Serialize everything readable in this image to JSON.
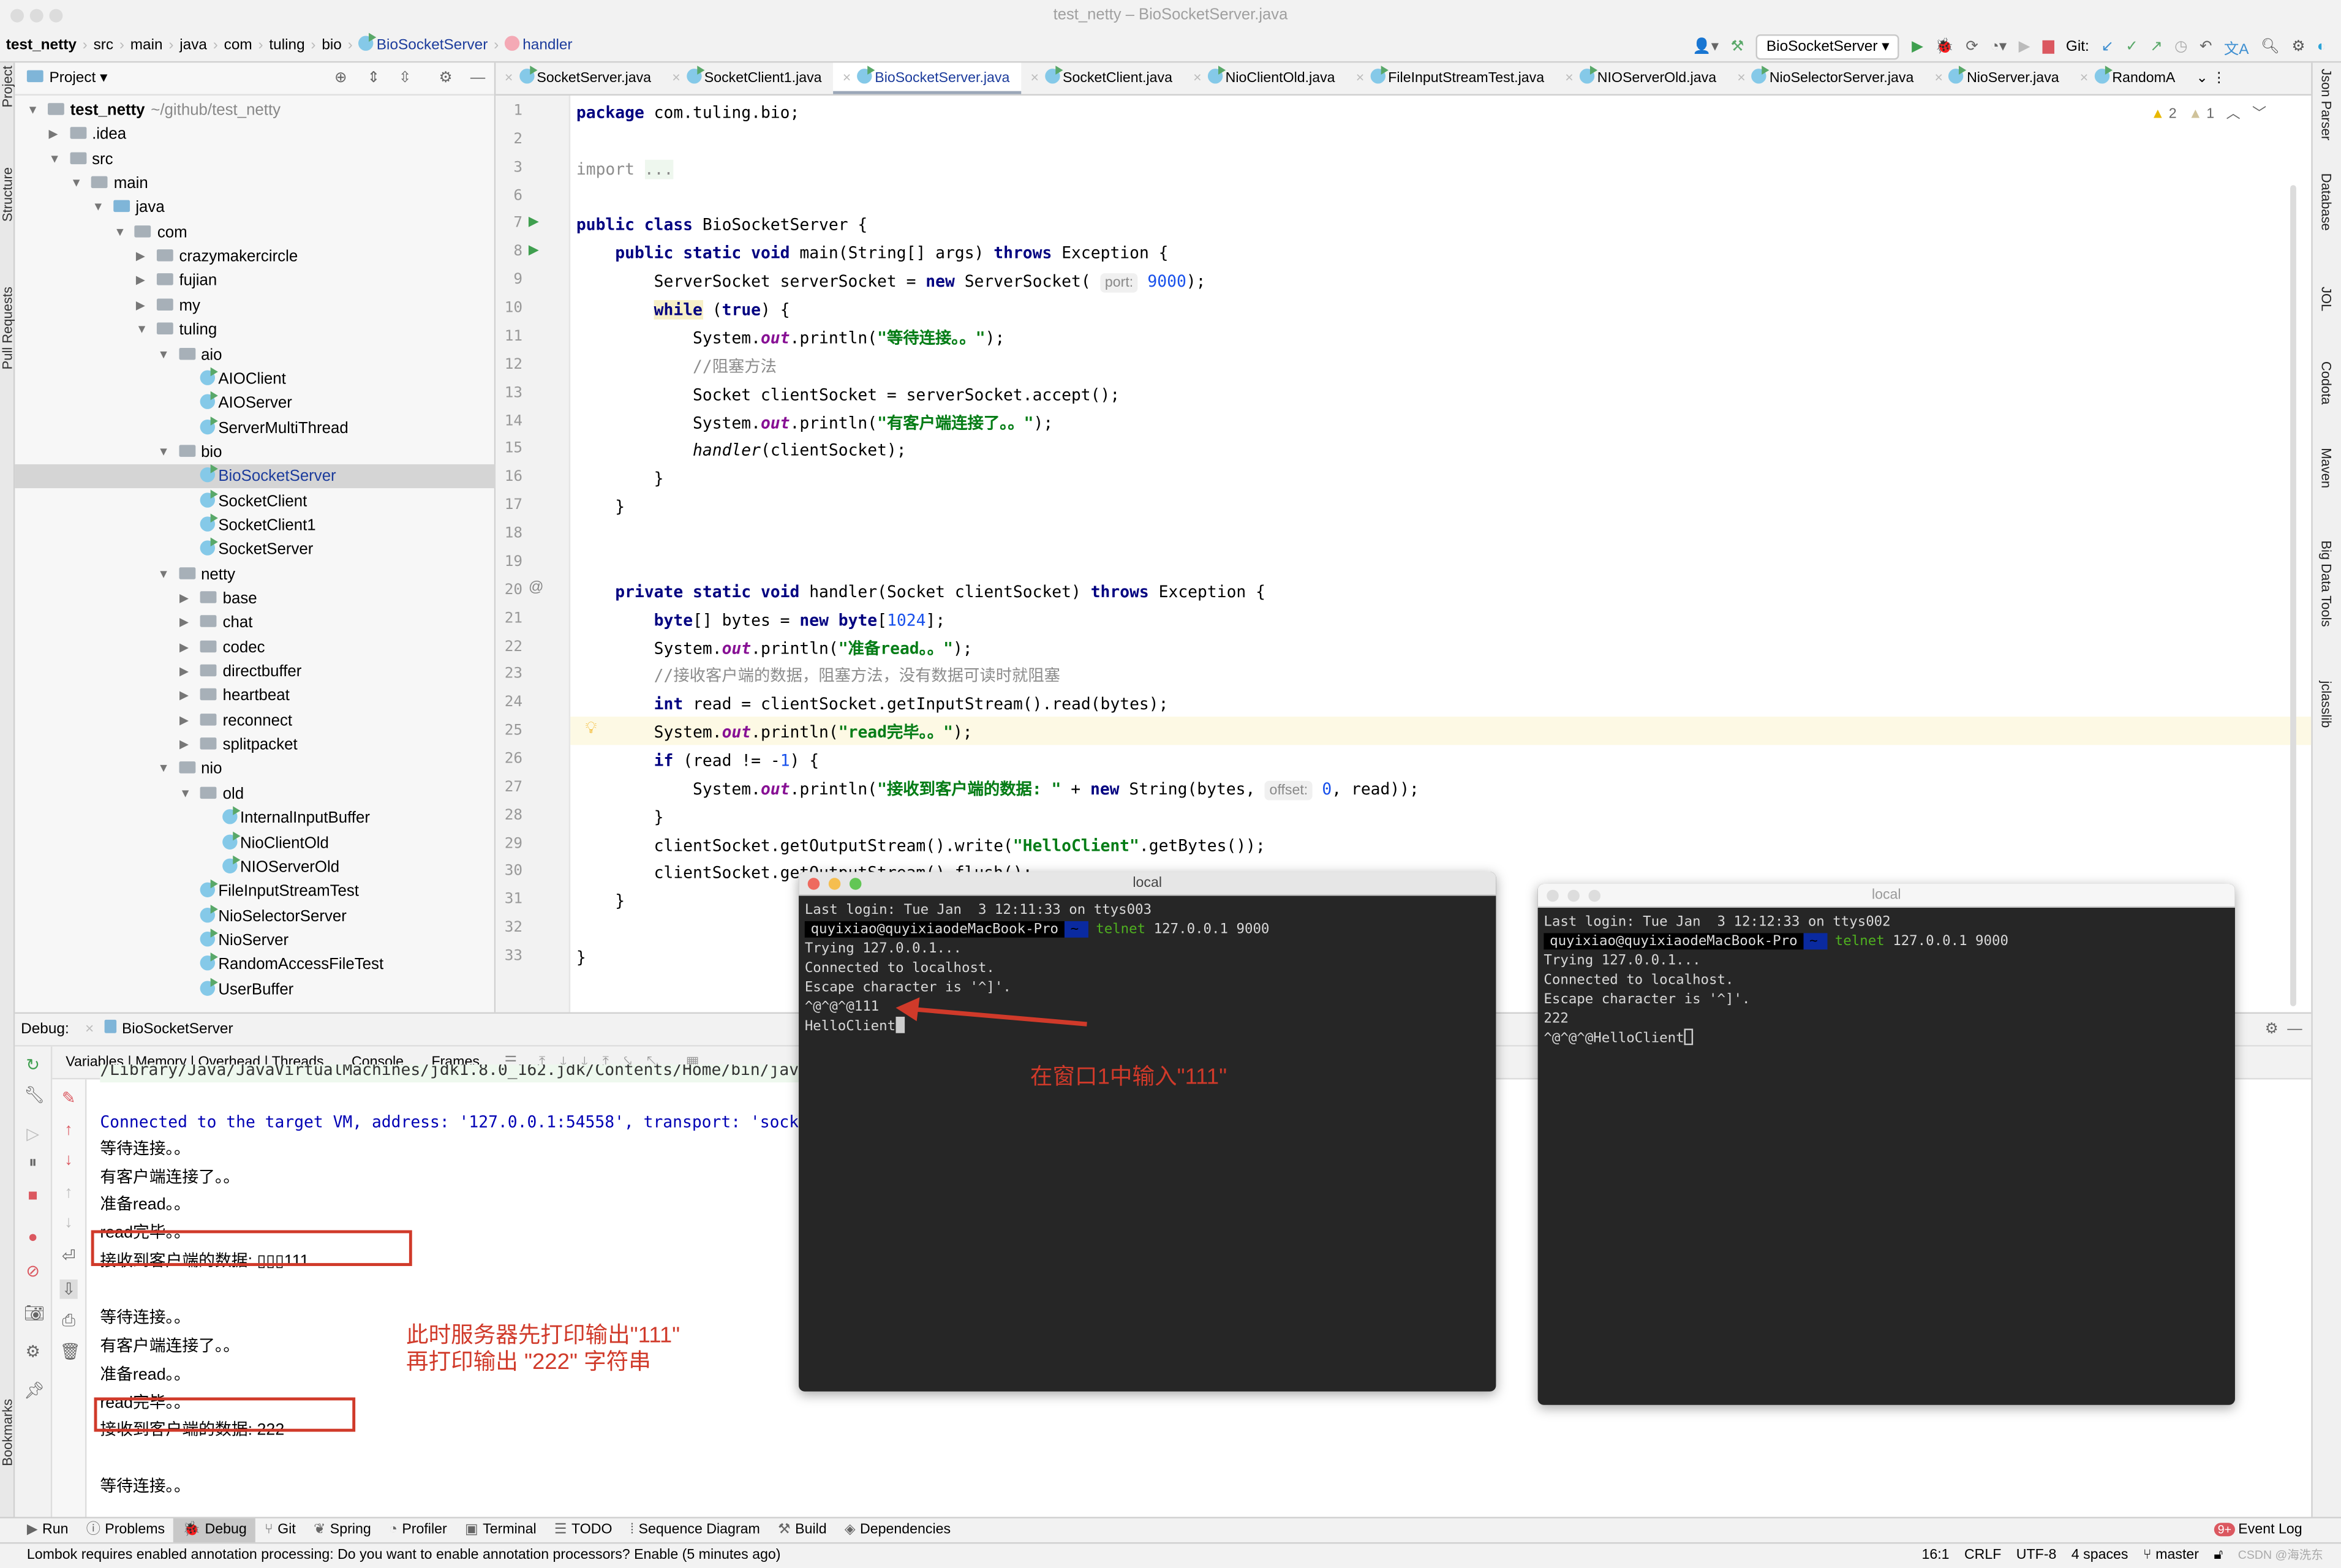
{
  "window": {
    "title": "test_netty – BioSocketServer.java"
  },
  "breadcrumb": [
    "test_netty",
    "src",
    "main",
    "java",
    "com",
    "tuling",
    "bio",
    "BioSocketServer",
    "handler"
  ],
  "toolbar": {
    "run_config": "BioSocketServer",
    "git_label": "Git:"
  },
  "left_strip": [
    "Project",
    "Structure",
    "Pull Requests",
    "Bookmarks"
  ],
  "right_strip": [
    "Json Parser",
    "Database",
    "JOL",
    "Codota",
    "Maven",
    "Big Data Tools",
    "jclasslib"
  ],
  "project": {
    "title": "Project",
    "tree": [
      {
        "label": "test_netty",
        "suffix": "~/github/test_netty",
        "depth": 0,
        "kind": "module",
        "arrow": "open"
      },
      {
        "label": ".idea",
        "depth": 1,
        "kind": "folder",
        "arrow": "closed"
      },
      {
        "label": "src",
        "depth": 1,
        "kind": "folder",
        "arrow": "open"
      },
      {
        "label": "main",
        "depth": 2,
        "kind": "folder",
        "arrow": "open"
      },
      {
        "label": "java",
        "depth": 3,
        "kind": "src",
        "arrow": "open"
      },
      {
        "label": "com",
        "depth": 4,
        "kind": "folder",
        "arrow": "open"
      },
      {
        "label": "crazymakercircle",
        "depth": 5,
        "kind": "folder",
        "arrow": "closed"
      },
      {
        "label": "fujian",
        "depth": 5,
        "kind": "folder",
        "arrow": "closed"
      },
      {
        "label": "my",
        "depth": 5,
        "kind": "folder",
        "arrow": "closed"
      },
      {
        "label": "tuling",
        "depth": 5,
        "kind": "folder",
        "arrow": "open"
      },
      {
        "label": "aio",
        "depth": 6,
        "kind": "folder",
        "arrow": "open"
      },
      {
        "label": "AIOClient",
        "depth": 7,
        "kind": "class"
      },
      {
        "label": "AIOServer",
        "depth": 7,
        "kind": "class"
      },
      {
        "label": "ServerMultiThread",
        "depth": 7,
        "kind": "class"
      },
      {
        "label": "bio",
        "depth": 6,
        "kind": "folder",
        "arrow": "open"
      },
      {
        "label": "BioSocketServer",
        "depth": 7,
        "kind": "class",
        "selected": true
      },
      {
        "label": "SocketClient",
        "depth": 7,
        "kind": "class"
      },
      {
        "label": "SocketClient1",
        "depth": 7,
        "kind": "class"
      },
      {
        "label": "SocketServer",
        "depth": 7,
        "kind": "class"
      },
      {
        "label": "netty",
        "depth": 6,
        "kind": "folder",
        "arrow": "open"
      },
      {
        "label": "base",
        "depth": 7,
        "kind": "folder",
        "arrow": "closed"
      },
      {
        "label": "chat",
        "depth": 7,
        "kind": "folder",
        "arrow": "closed"
      },
      {
        "label": "codec",
        "depth": 7,
        "kind": "folder",
        "arrow": "closed"
      },
      {
        "label": "directbuffer",
        "depth": 7,
        "kind": "folder",
        "arrow": "closed"
      },
      {
        "label": "heartbeat",
        "depth": 7,
        "kind": "folder",
        "arrow": "closed"
      },
      {
        "label": "reconnect",
        "depth": 7,
        "kind": "folder",
        "arrow": "closed"
      },
      {
        "label": "splitpacket",
        "depth": 7,
        "kind": "folder",
        "arrow": "closed"
      },
      {
        "label": "nio",
        "depth": 6,
        "kind": "folder",
        "arrow": "open"
      },
      {
        "label": "old",
        "depth": 7,
        "kind": "folder",
        "arrow": "open"
      },
      {
        "label": "InternalInputBuffer",
        "depth": 8,
        "kind": "class"
      },
      {
        "label": "NioClientOld",
        "depth": 8,
        "kind": "class"
      },
      {
        "label": "NIOServerOld",
        "depth": 8,
        "kind": "class"
      },
      {
        "label": "FileInputStreamTest",
        "depth": 7,
        "kind": "class"
      },
      {
        "label": "NioSelectorServer",
        "depth": 7,
        "kind": "class"
      },
      {
        "label": "NioServer",
        "depth": 7,
        "kind": "class"
      },
      {
        "label": "RandomAccessFileTest",
        "depth": 7,
        "kind": "class"
      },
      {
        "label": "UserBuffer",
        "depth": 7,
        "kind": "class"
      }
    ]
  },
  "tabs": [
    {
      "label": "SocketServer.java"
    },
    {
      "label": "SocketClient1.java"
    },
    {
      "label": "BioSocketServer.java",
      "active": true
    },
    {
      "label": "SocketClient.java"
    },
    {
      "label": "NioClientOld.java"
    },
    {
      "label": "FileInputStreamTest.java"
    },
    {
      "label": "NIOServerOld.java"
    },
    {
      "label": "NioSelectorServer.java"
    },
    {
      "label": "NioServer.java"
    },
    {
      "label": "RandomA"
    }
  ],
  "editor": {
    "inspections": {
      "warnings": "2",
      "weak_warnings": "1"
    },
    "current_line": "25",
    "lines": [
      {
        "n": "1",
        "t": [
          [
            "kw",
            "package"
          ],
          [
            "p",
            " com.tuling.bio;"
          ]
        ]
      },
      {
        "n": "2",
        "t": []
      },
      {
        "n": "3",
        "t": [
          [
            "cm",
            "import "
          ],
          [
            "fold",
            "..."
          ]
        ]
      },
      {
        "n": "6",
        "t": []
      },
      {
        "n": "7",
        "t": [
          [
            "kw",
            "public class"
          ],
          [
            "p",
            " BioSocketServer {"
          ]
        ]
      },
      {
        "n": "8",
        "t": [
          [
            "p",
            "    "
          ],
          [
            "kw",
            "public static void"
          ],
          [
            "p",
            " main(String[] args) "
          ],
          [
            "kw",
            "throws"
          ],
          [
            "p",
            " Exception {"
          ]
        ]
      },
      {
        "n": "9",
        "t": [
          [
            "p",
            "        ServerSocket serverSocket = "
          ],
          [
            "kw",
            "new"
          ],
          [
            "p",
            " ServerSocket( "
          ],
          [
            "hint",
            "port:"
          ],
          [
            "p",
            " "
          ],
          [
            "num",
            "9000"
          ],
          [
            "p",
            ");"
          ]
        ]
      },
      {
        "n": "10",
        "t": [
          [
            "p",
            "        "
          ],
          [
            "kw wl",
            "while"
          ],
          [
            "p",
            " ("
          ],
          [
            "kw",
            "true"
          ],
          [
            "p",
            ") {"
          ]
        ]
      },
      {
        "n": "11",
        "t": [
          [
            "p",
            "            System."
          ],
          [
            "fld",
            "out"
          ],
          [
            "p",
            ".println("
          ],
          [
            "str",
            "\"等待连接。。\""
          ],
          [
            "p",
            ");"
          ]
        ]
      },
      {
        "n": "12",
        "t": [
          [
            "p",
            "            "
          ],
          [
            "cm",
            "//阻塞方法"
          ]
        ]
      },
      {
        "n": "13",
        "t": [
          [
            "p",
            "            Socket clientSocket = serverSocket.accept();"
          ]
        ]
      },
      {
        "n": "14",
        "t": [
          [
            "p",
            "            System."
          ],
          [
            "fld",
            "out"
          ],
          [
            "p",
            ".println("
          ],
          [
            "str",
            "\"有客户端连接了。。\""
          ],
          [
            "p",
            ");"
          ]
        ]
      },
      {
        "n": "15",
        "t": [
          [
            "p",
            "            "
          ],
          [
            "it",
            "handler"
          ],
          [
            "p",
            "(clientSocket);"
          ]
        ]
      },
      {
        "n": "16",
        "t": [
          [
            "p",
            "        }"
          ]
        ]
      },
      {
        "n": "17",
        "t": [
          [
            "p",
            "    }"
          ]
        ]
      },
      {
        "n": "18",
        "t": []
      },
      {
        "n": "19",
        "t": []
      },
      {
        "n": "20",
        "t": [
          [
            "p",
            "    "
          ],
          [
            "kw",
            "private static void"
          ],
          [
            "p",
            " handler(Socket clientSocket) "
          ],
          [
            "kw",
            "throws"
          ],
          [
            "p",
            " Exception {"
          ]
        ]
      },
      {
        "n": "21",
        "t": [
          [
            "p",
            "        "
          ],
          [
            "kw",
            "byte"
          ],
          [
            "p",
            "[] bytes = "
          ],
          [
            "kw",
            "new byte"
          ],
          [
            "p",
            "["
          ],
          [
            "num",
            "1024"
          ],
          [
            "p",
            "];"
          ]
        ]
      },
      {
        "n": "22",
        "t": [
          [
            "p",
            "        System."
          ],
          [
            "fld",
            "out"
          ],
          [
            "p",
            ".println("
          ],
          [
            "str",
            "\"准备read。。\""
          ],
          [
            "p",
            ");"
          ]
        ]
      },
      {
        "n": "23",
        "t": [
          [
            "p",
            "        "
          ],
          [
            "cm",
            "//接收客户端的数据，阻塞方法，没有数据可读时就阻塞"
          ]
        ]
      },
      {
        "n": "24",
        "t": [
          [
            "p",
            "        "
          ],
          [
            "kw",
            "int"
          ],
          [
            "p",
            " read = clientSocket.getInputStream().read(bytes);"
          ]
        ]
      },
      {
        "n": "25",
        "t": [
          [
            "p",
            "        System."
          ],
          [
            "fld",
            "out"
          ],
          [
            "p",
            ".println("
          ],
          [
            "str",
            "\"read完毕。。\""
          ],
          [
            "p",
            ");"
          ]
        ]
      },
      {
        "n": "26",
        "t": [
          [
            "p",
            "        "
          ],
          [
            "kw",
            "if"
          ],
          [
            "p",
            " (read != -"
          ],
          [
            "num",
            "1"
          ],
          [
            "p",
            ") {"
          ]
        ]
      },
      {
        "n": "27",
        "t": [
          [
            "p",
            "            System."
          ],
          [
            "fld",
            "out"
          ],
          [
            "p",
            ".println("
          ],
          [
            "str",
            "\"接收到客户端的数据: \""
          ],
          [
            "p",
            " + "
          ],
          [
            "kw",
            "new"
          ],
          [
            "p",
            " String(bytes, "
          ],
          [
            "hint",
            "offset:"
          ],
          [
            "p",
            " "
          ],
          [
            "num",
            "0"
          ],
          [
            "p",
            ", read));"
          ]
        ]
      },
      {
        "n": "28",
        "t": [
          [
            "p",
            "        }"
          ]
        ]
      },
      {
        "n": "29",
        "t": [
          [
            "p",
            "        clientSocket.getOutputStream().write("
          ],
          [
            "str",
            "\"HelloClient\""
          ],
          [
            "p",
            ".getBytes());"
          ]
        ]
      },
      {
        "n": "30",
        "t": [
          [
            "p",
            "        clientSocket.getOutputStream().flush();"
          ]
        ]
      },
      {
        "n": "31",
        "t": [
          [
            "p",
            "    }"
          ]
        ]
      },
      {
        "n": "32",
        "t": []
      },
      {
        "n": "33",
        "t": [
          [
            "p",
            "}"
          ]
        ]
      }
    ]
  },
  "debug": {
    "label": "Debug:",
    "session": "BioSocketServer",
    "tabs": [
      "Variables | Memory | Overhead | Threads",
      "Console",
      "Frames"
    ],
    "console": [
      {
        "text": "/Library/Java/JavaVirtualMachines/jdk1.8.0_162.jdk/Contents/Home/bin/java ...",
        "mono": true,
        "cut": true
      },
      {
        "text": "Connected to the target VM, address: '127.0.0.1:54558', transport: 'socket'",
        "mono": true
      },
      {
        "text": "等待连接。。"
      },
      {
        "text": "有客户端连接了。。"
      },
      {
        "text": "准备read。。"
      },
      {
        "text": "read完毕。。"
      },
      {
        "text": "接收到客户端的数据: ▯▯▯111"
      },
      {
        "text": ""
      },
      {
        "text": "等待连接。。"
      },
      {
        "text": "有客户端连接了。。"
      },
      {
        "text": "准备read。。"
      },
      {
        "text": "read完毕。。"
      },
      {
        "text": "接收到客户端的数据: 222"
      },
      {
        "text": ""
      },
      {
        "text": "等待连接。。"
      }
    ]
  },
  "terminals": [
    {
      "title": "local",
      "active": true,
      "last_login": "Last login: Tue Jan  3 12:11:33 on ttys003",
      "prompt": "quyixiao@quyixiaodeMacBook-Pro",
      "dir": "~",
      "cmd": "telnet",
      "args": " 127.0.0.1 9000",
      "output": [
        "Trying 127.0.0.1...",
        "Connected to localhost.",
        "Escape character is '^]'.",
        "^@^@^@111"
      ],
      "last": "HelloClient"
    },
    {
      "title": "local",
      "active": false,
      "last_login": "Last login: Tue Jan  3 12:12:33 on ttys002",
      "prompt": "quyixiao@quyixiaodeMacBook-Pro",
      "dir": "~",
      "cmd": "telnet",
      "args": " 127.0.0.1 9000",
      "output": [
        "Trying 127.0.0.1...",
        "Connected to localhost.",
        "Escape character is '^]'.",
        "222"
      ],
      "last": "^@^@^@HelloClient"
    }
  ],
  "annotations": {
    "note1": "在窗口1中输入\"111\"",
    "note2": "此时服务器先打印输出\"111\"\n再打印输出 \"222\" 字符串",
    "color": "#d03a2a"
  },
  "toolwindows": [
    "Run",
    "Problems",
    "Debug",
    "Git",
    "Spring",
    "Profiler",
    "Terminal",
    "TODO",
    "Sequence Diagram",
    "Build",
    "Dependencies"
  ],
  "event_log": {
    "badge": "9+",
    "label": "Event Log"
  },
  "status": {
    "message": "Lombok requires enabled annotation processing: Do you want to enable annotation processors? Enable (5 minutes ago)",
    "position": "16:1",
    "line_sep": "CRLF",
    "encoding": "UTF-8",
    "indent": "4 spaces",
    "branch": "master",
    "watermark": "CSDN @海洗东"
  }
}
